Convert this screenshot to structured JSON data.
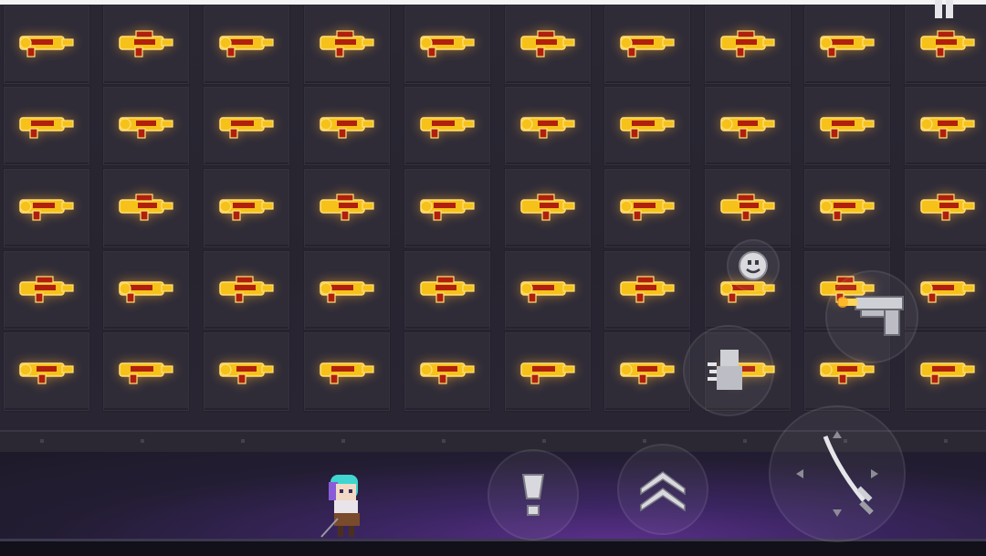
{
  "scene": {
    "title": "",
    "grid_columns": 10,
    "grid_rows": 5
  },
  "colors": {
    "wall": "#2a2733",
    "slot": "#2f2c38",
    "gun_gold": "#f6c21a",
    "gun_red": "#b0200c",
    "gun_outline": "#ffe07a",
    "floor_glow": "#5a2f8a"
  },
  "weapons": [
    [
      "keyblade-gun",
      "dragon-rifle",
      "gold-blaster",
      "ring-blaster",
      "gold-pistol",
      "twin-barrel-rifle",
      "winged-cannon",
      "dome-blaster",
      "claw-rifle",
      "heavy-cannon"
    ],
    [
      "fish-gun",
      "gatling-cannon",
      "gold-key",
      "long-rifle",
      "capsule-gun",
      "bolt-rifle",
      "hook-pistol",
      "striped-rifle",
      "star-gun",
      "crate-gun"
    ],
    [
      "square-cannon",
      "serpent-rifle",
      "sleek-pistol",
      "beast-rifle",
      "horn-blaster",
      "slash-cannon",
      "orb-blaster",
      "arrow-launcher",
      "bullet-gun",
      "dragon-cannon"
    ],
    [
      "tube-rifle",
      "wing-rifle",
      "slanted-blaster",
      "barrel-gun",
      "crank-blaster",
      "spiked-rifle",
      "flame-gun",
      "key-launcher",
      "flash-blaster",
      "shark-gun"
    ],
    [
      "snake-rifle",
      "drill-rifle",
      "battery-gun",
      "coil-blaster",
      "long-pistol",
      "guitar-gun",
      "grenade-gun",
      "blob-rifle",
      "leaf-cannon",
      "triple-blaster"
    ]
  ],
  "controls": {
    "emote": "smiley-icon",
    "weapon_swap": "pistol-icon",
    "skill": "character-skill-icon",
    "interact": "flashlight-icon",
    "jump": "double-chevron-up-icon",
    "attack": "sword-icon",
    "pause": "pause-icon"
  },
  "player": {
    "name_shown": ""
  }
}
